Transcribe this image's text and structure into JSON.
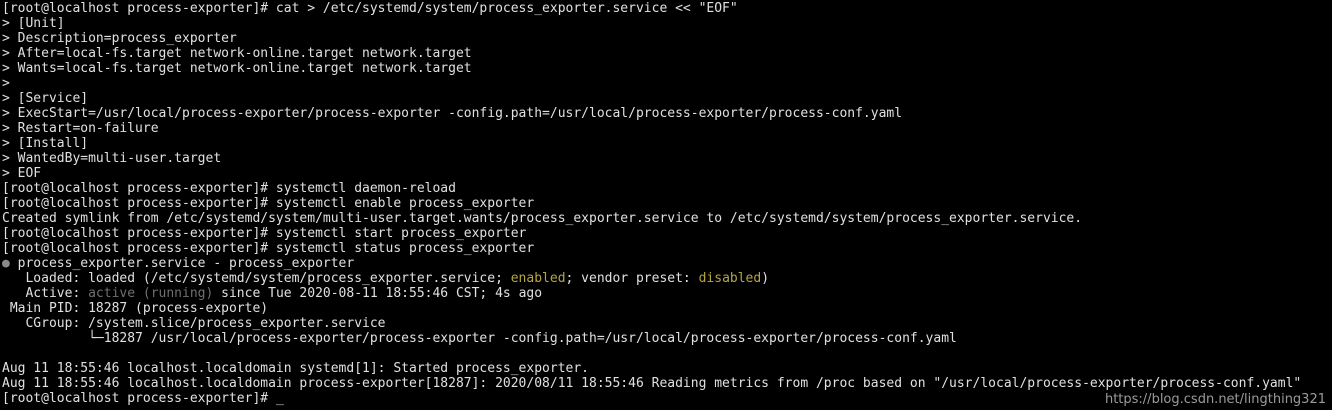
{
  "terminal": {
    "lines": [
      "[root@localhost process-exporter]# cat > /etc/systemd/system/process_exporter.service << \"EOF\"",
      "> [Unit]",
      "> Description=process_exporter",
      "> After=local-fs.target network-online.target network.target",
      "> Wants=local-fs.target network-online.target network.target",
      ">",
      "> [Service]",
      "> ExecStart=/usr/local/process-exporter/process-exporter -config.path=/usr/local/process-exporter/process-conf.yaml",
      "> Restart=on-failure",
      "> [Install]",
      "> WantedBy=multi-user.target",
      "> EOF",
      "[root@localhost process-exporter]# systemctl daemon-reload",
      "[root@localhost process-exporter]# systemctl enable process_exporter",
      "Created symlink from /etc/systemd/system/multi-user.target.wants/process_exporter.service to /etc/systemd/system/process_exporter.service.",
      "[root@localhost process-exporter]# systemctl start process_exporter",
      "[root@localhost process-exporter]# systemctl status process_exporter"
    ],
    "status": {
      "bullet": "●",
      "title": " process_exporter.service - process_exporter",
      "loaded_prefix": "   Loaded: loaded (/etc/systemd/system/process_exporter.service; ",
      "loaded_enabled": "enabled",
      "loaded_mid": "; vendor preset: ",
      "loaded_disabled": "disabled",
      "loaded_suffix": ")",
      "active_prefix": "   Active: ",
      "active_state": "active (running)",
      "active_suffix": " since Tue 2020-08-11 18:55:46 CST; 4s ago",
      "main_pid": " Main PID: 18287 (process-exporte)",
      "cgroup": "   CGroup: /system.slice/process_exporter.service",
      "cgroup_child": "           └─18287 /usr/local/process-exporter/process-exporter -config.path=/usr/local/process-exporter/process-conf.yaml"
    },
    "logs": [
      "",
      "Aug 11 18:55:46 localhost.localdomain systemd[1]: Started process_exporter.",
      "Aug 11 18:55:46 localhost.localdomain process-exporter[18287]: 2020/08/11 18:55:46 Reading metrics from /proc based on \"/usr/local/process-exporter/process-conf.yaml\""
    ],
    "final_prompt": "[root@localhost process-exporter]# ",
    "cursor": "_"
  },
  "watermark": "https://blog.csdn.net/lingthing321",
  "colors": {
    "background": "#000000",
    "text": "#e0e0e0",
    "enabled_yellow": "#b5a642",
    "dim_gray": "#6f6f6f"
  }
}
